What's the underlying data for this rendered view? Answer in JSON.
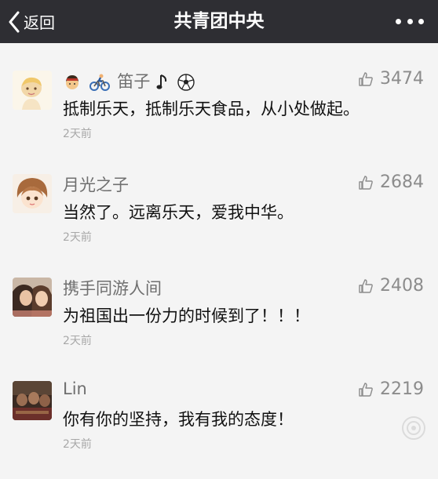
{
  "header": {
    "back_label": "返回",
    "title": "共青团中央"
  },
  "comments": [
    {
      "name": "笛子",
      "likes": "3474",
      "text": "抵制乐天，抵制乐天食品，从小处做起。",
      "time": "2天前",
      "name_icons": [
        "person-emoji-icon",
        "cyclist-emoji-icon",
        "music-note-emoji-icon",
        "soccer-ball-emoji-icon"
      ]
    },
    {
      "name": "月光之子",
      "likes": "2684",
      "text": "当然了。远离乐天，爱我中华。",
      "time": "2天前"
    },
    {
      "name": "携手同游人间",
      "likes": "2408",
      "text": "为祖国出一份力的时候到了！！！",
      "time": "2天前"
    },
    {
      "name": "Lin",
      "likes": "2219",
      "text": "你有你的坚持，我有我的态度！",
      "time": "2天前"
    }
  ],
  "colors": {
    "header_bg": "#2e2e33",
    "page_bg": "#f4f4f4",
    "name": "#6f6f6f",
    "text": "#111111",
    "meta": "#a8a8a8"
  }
}
